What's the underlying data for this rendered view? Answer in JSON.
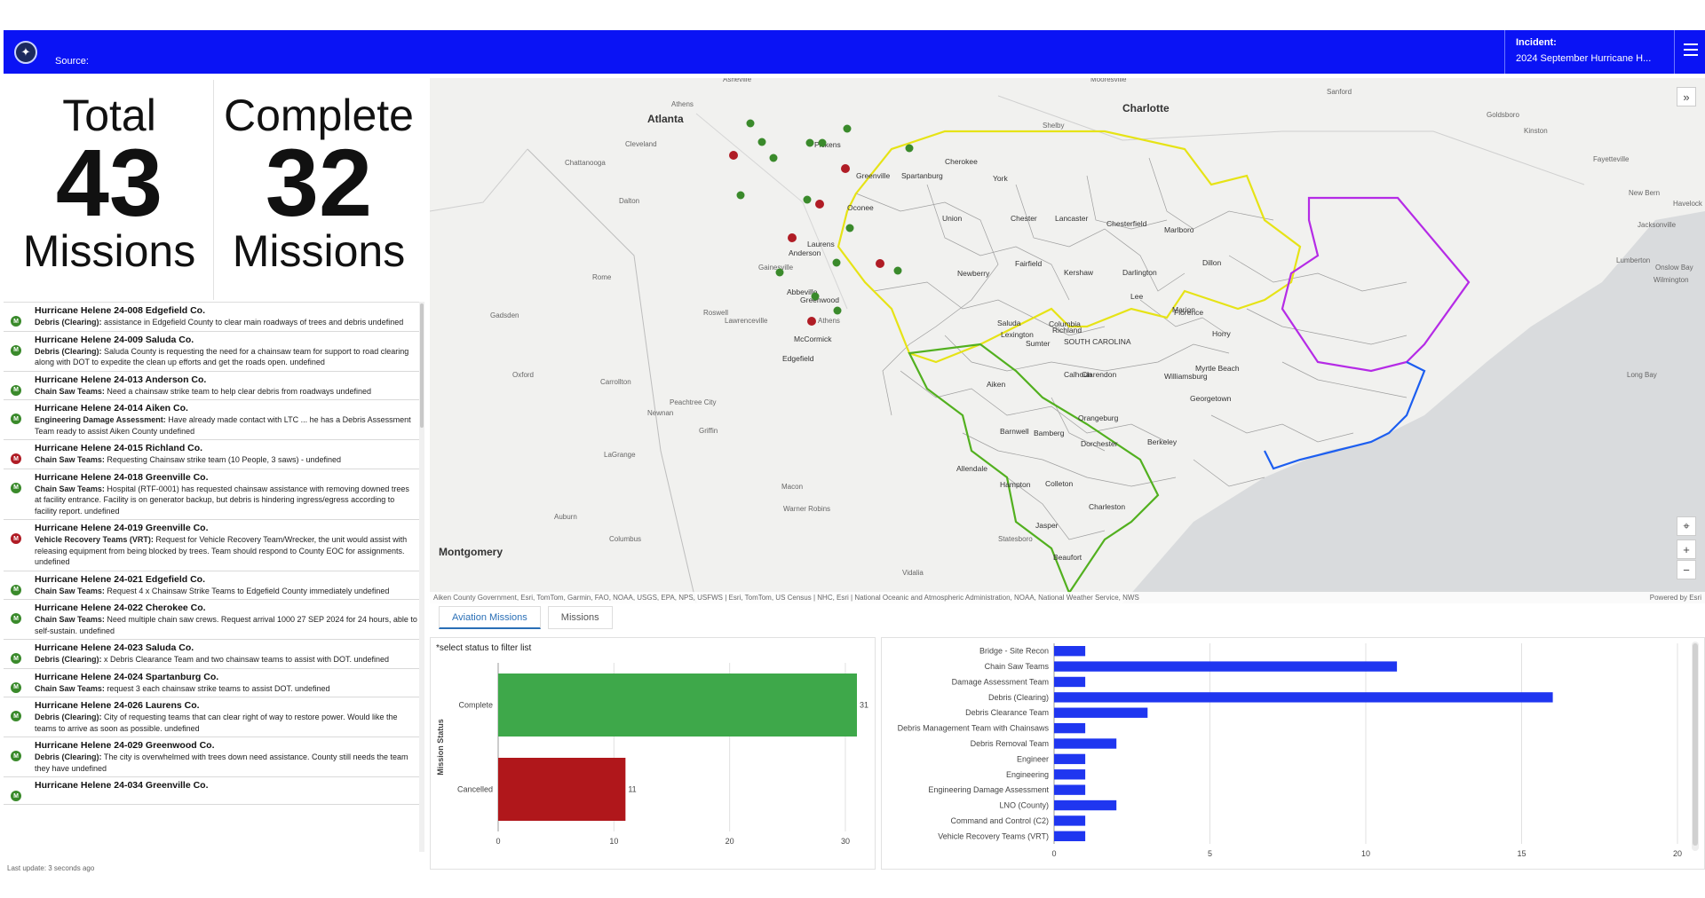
{
  "header": {
    "logo_icon": "seal-logo-icon",
    "source_label": "Source:",
    "incident_label": "Incident:",
    "incident_value": "2024 September Hurricane H...",
    "menu_icon": "hamburger-menu-icon",
    "background_color": "#0a13f5"
  },
  "counters": {
    "total": {
      "top": "Total",
      "number": "43",
      "bottom": "Missions"
    },
    "complete": {
      "top": "Complete",
      "number": "32",
      "bottom": "Missions"
    }
  },
  "mission_list": {
    "items": [
      {
        "title": "Hurricane Helene 24-008 Edgefield Co.",
        "status": "complete",
        "category": "Debris (Clearing):",
        "text": "assistance in Edgefield County to clear main roadways of trees and debris undefined"
      },
      {
        "title": "Hurricane Helene 24-009 Saluda Co.",
        "status": "complete",
        "category": "Debris (Clearing):",
        "text": "Saluda County is requesting the need for a chainsaw team for support to road clearing along with DOT to expedite the clean up efforts and get the roads open. undefined"
      },
      {
        "title": "Hurricane Helene 24-013 Anderson Co.",
        "status": "complete",
        "category": "Chain Saw Teams:",
        "text": "Need a chainsaw strike team to help clear debris from roadways undefined"
      },
      {
        "title": "Hurricane Helene 24-014 Aiken Co.",
        "status": "complete",
        "category": "Engineering Damage Assessment:",
        "text": "Have already made contact with LTC ... he has a Debris Assessment Team ready to assist Aiken County undefined"
      },
      {
        "title": "Hurricane Helene 24-015 Richland Co.",
        "status": "cancelled",
        "category": "Chain Saw Teams:",
        "text": "Requesting Chainsaw strike team (10 People, 3 saws) - undefined"
      },
      {
        "title": "Hurricane Helene 24-018 Greenville Co.",
        "status": "complete",
        "category": "Chain Saw Teams:",
        "text": "Hospital (RTF-0001) has requested chainsaw assistance with removing downed trees at facility entrance. Facility is on generator backup, but debris is hindering ingress/egress according to facility report. undefined"
      },
      {
        "title": "Hurricane Helene 24-019 Greenville Co.",
        "status": "cancelled",
        "category": "Vehicle Recovery Teams (VRT):",
        "text": "Request for Vehicle Recovery Team/Wrecker, the unit would assist with releasing equipment from being blocked by trees. Team should respond to County EOC for assignments. undefined"
      },
      {
        "title": "Hurricane Helene 24-021 Edgefield Co.",
        "status": "complete",
        "category": "Chain Saw Teams:",
        "text": "Request 4 x Chainsaw Strike Teams to Edgefield County immediately undefined"
      },
      {
        "title": "Hurricane Helene 24-022 Cherokee Co.",
        "status": "complete",
        "category": "Chain Saw Teams:",
        "text": "Need multiple chain saw crews. Request arrival 1000 27 SEP 2024 for 24 hours, able to self-sustain. undefined"
      },
      {
        "title": "Hurricane Helene 24-023 Saluda Co.",
        "status": "complete",
        "category": "Debris (Clearing):",
        "text": "x Debris Clearance Team and two chainsaw teams to assist with DOT. undefined"
      },
      {
        "title": "Hurricane Helene 24-024 Spartanburg Co.",
        "status": "complete",
        "category": "Chain Saw Teams:",
        "text": "request 3 each chainsaw strike teams to assist DOT. undefined"
      },
      {
        "title": "Hurricane Helene 24-026 Laurens Co.",
        "status": "complete",
        "category": "Debris (Clearing):",
        "text": "City of requesting teams that can clear right of way to restore power. Would like the teams to arrive as soon as possible. undefined"
      },
      {
        "title": "Hurricane Helene 24-029 Greenwood Co.",
        "status": "complete",
        "category": "Debris (Clearing):",
        "text": "The city is overwhelmed with trees down need assistance. County still needs the team they have undefined"
      },
      {
        "title": "Hurricane Helene 24-034 Greenville Co.",
        "status": "complete",
        "category": "",
        "text": ""
      }
    ],
    "last_update": "Last update: 3 seconds ago",
    "colors": {
      "complete": "#3a8a2b",
      "cancelled": "#b01c25"
    }
  },
  "map": {
    "attribution": "Aiken County Government, Esri, TomTom, Garmin, FAO, NOAA, USGS, EPA, NPS, USFWS | Esri, TomTom, US Census | NHC, Esri | National Oceanic and Atmospheric Administration, NOAA, National Weather Service, NWS",
    "powered_by": "Powered by Esri",
    "collapse_icon": "chevron-double-down-icon",
    "locate_icon": "locate-icon",
    "zoom_in": "+",
    "zoom_out": "−",
    "cities": [
      {
        "name": "Charlotte",
        "bold": true
      },
      {
        "name": "Atlanta",
        "bold": true
      },
      {
        "name": "Asheville"
      },
      {
        "name": "Mooresville"
      },
      {
        "name": "Sanford"
      },
      {
        "name": "Goldsboro"
      },
      {
        "name": "Athens"
      },
      {
        "name": "Shelby"
      },
      {
        "name": "Kinston"
      },
      {
        "name": "Fayetteville"
      },
      {
        "name": "Cleveland"
      },
      {
        "name": "Chattanooga"
      },
      {
        "name": "New Bern"
      },
      {
        "name": "Havelock"
      },
      {
        "name": "Dalton"
      },
      {
        "name": "Jacksonville"
      },
      {
        "name": "Lumberton"
      },
      {
        "name": "Gainesville"
      },
      {
        "name": "Rome"
      },
      {
        "name": "Wilmington"
      },
      {
        "name": "Gadsden"
      },
      {
        "name": "Roswell"
      },
      {
        "name": "Lawrenceville"
      },
      {
        "name": "Athens"
      },
      {
        "name": "Oxford"
      },
      {
        "name": "Carrollton"
      },
      {
        "name": "Peachtree City"
      },
      {
        "name": "Newnan"
      },
      {
        "name": "Griffin"
      },
      {
        "name": "LaGrange"
      },
      {
        "name": "Macon"
      },
      {
        "name": "Warner Robins"
      },
      {
        "name": "Auburn"
      },
      {
        "name": "Columbus"
      },
      {
        "name": "Statesboro"
      },
      {
        "name": "Montgomery",
        "bold": true
      },
      {
        "name": "Vidalia"
      },
      {
        "name": "Onslow Bay"
      },
      {
        "name": "Long Bay"
      }
    ],
    "counties": [
      "Oconee",
      "Pickens",
      "Greenville",
      "Spartanburg",
      "Cherokee",
      "York",
      "Chester",
      "Lancaster",
      "Chesterfield",
      "Marlboro",
      "Dillon",
      "Union",
      "Laurens",
      "Newberry",
      "Fairfield",
      "Kershaw",
      "Darlington",
      "Marion",
      "Anderson",
      "Abbeville",
      "Greenwood",
      "Saluda",
      "Lexington",
      "Richland",
      "Lee",
      "Florence",
      "Horry",
      "McCormick",
      "Edgefield",
      "Aiken",
      "Sumter",
      "Clarendon",
      "Williamsburg",
      "Georgetown",
      "Calhoun",
      "Orangeburg",
      "Barnwell",
      "Bamberg",
      "Dorchester",
      "Berkeley",
      "Allendale",
      "Hampton",
      "Colleton",
      "Charleston",
      "Jasper",
      "Beaufort",
      "Columbia",
      "SOUTH CAROLINA",
      "Myrtle Beach"
    ]
  },
  "tabs": [
    {
      "label": "Aviation Missions",
      "active": true
    },
    {
      "label": "Missions",
      "active": false
    }
  ],
  "status_chart": {
    "note": "*select status to filter list",
    "chart_data": {
      "type": "bar",
      "orientation": "horizontal",
      "categories": [
        "Complete",
        "Cancelled"
      ],
      "values": [
        31,
        11
      ],
      "colors": [
        "#3ea84a",
        "#b0171b"
      ],
      "ylabel": "Mission Status",
      "xlim": [
        0,
        31
      ],
      "xticks": [
        "0",
        "10",
        "20",
        "30"
      ],
      "grid": true
    }
  },
  "type_chart": {
    "chart_data": {
      "type": "bar",
      "orientation": "horizontal",
      "categories": [
        "Bridge - Site Recon",
        "Chain Saw Teams",
        "Damage Assessment Team",
        "Debris (Clearing)",
        "Debris Clearance Team",
        "Debris Management Team with Chainsaws",
        "Debris Removal Team",
        "Engineer",
        "Engineering",
        "Engineering Damage Assessment",
        "LNO (County)",
        "Command and Control (C2)",
        "Vehicle Recovery Teams (VRT)"
      ],
      "values": [
        1,
        11,
        1,
        16,
        3,
        1,
        2,
        1,
        1,
        1,
        2,
        1,
        1
      ],
      "color": "#1f36f0",
      "xlim": [
        0,
        20
      ],
      "xticks": [
        "0",
        "5",
        "10",
        "15",
        "20"
      ],
      "grid": true
    }
  }
}
